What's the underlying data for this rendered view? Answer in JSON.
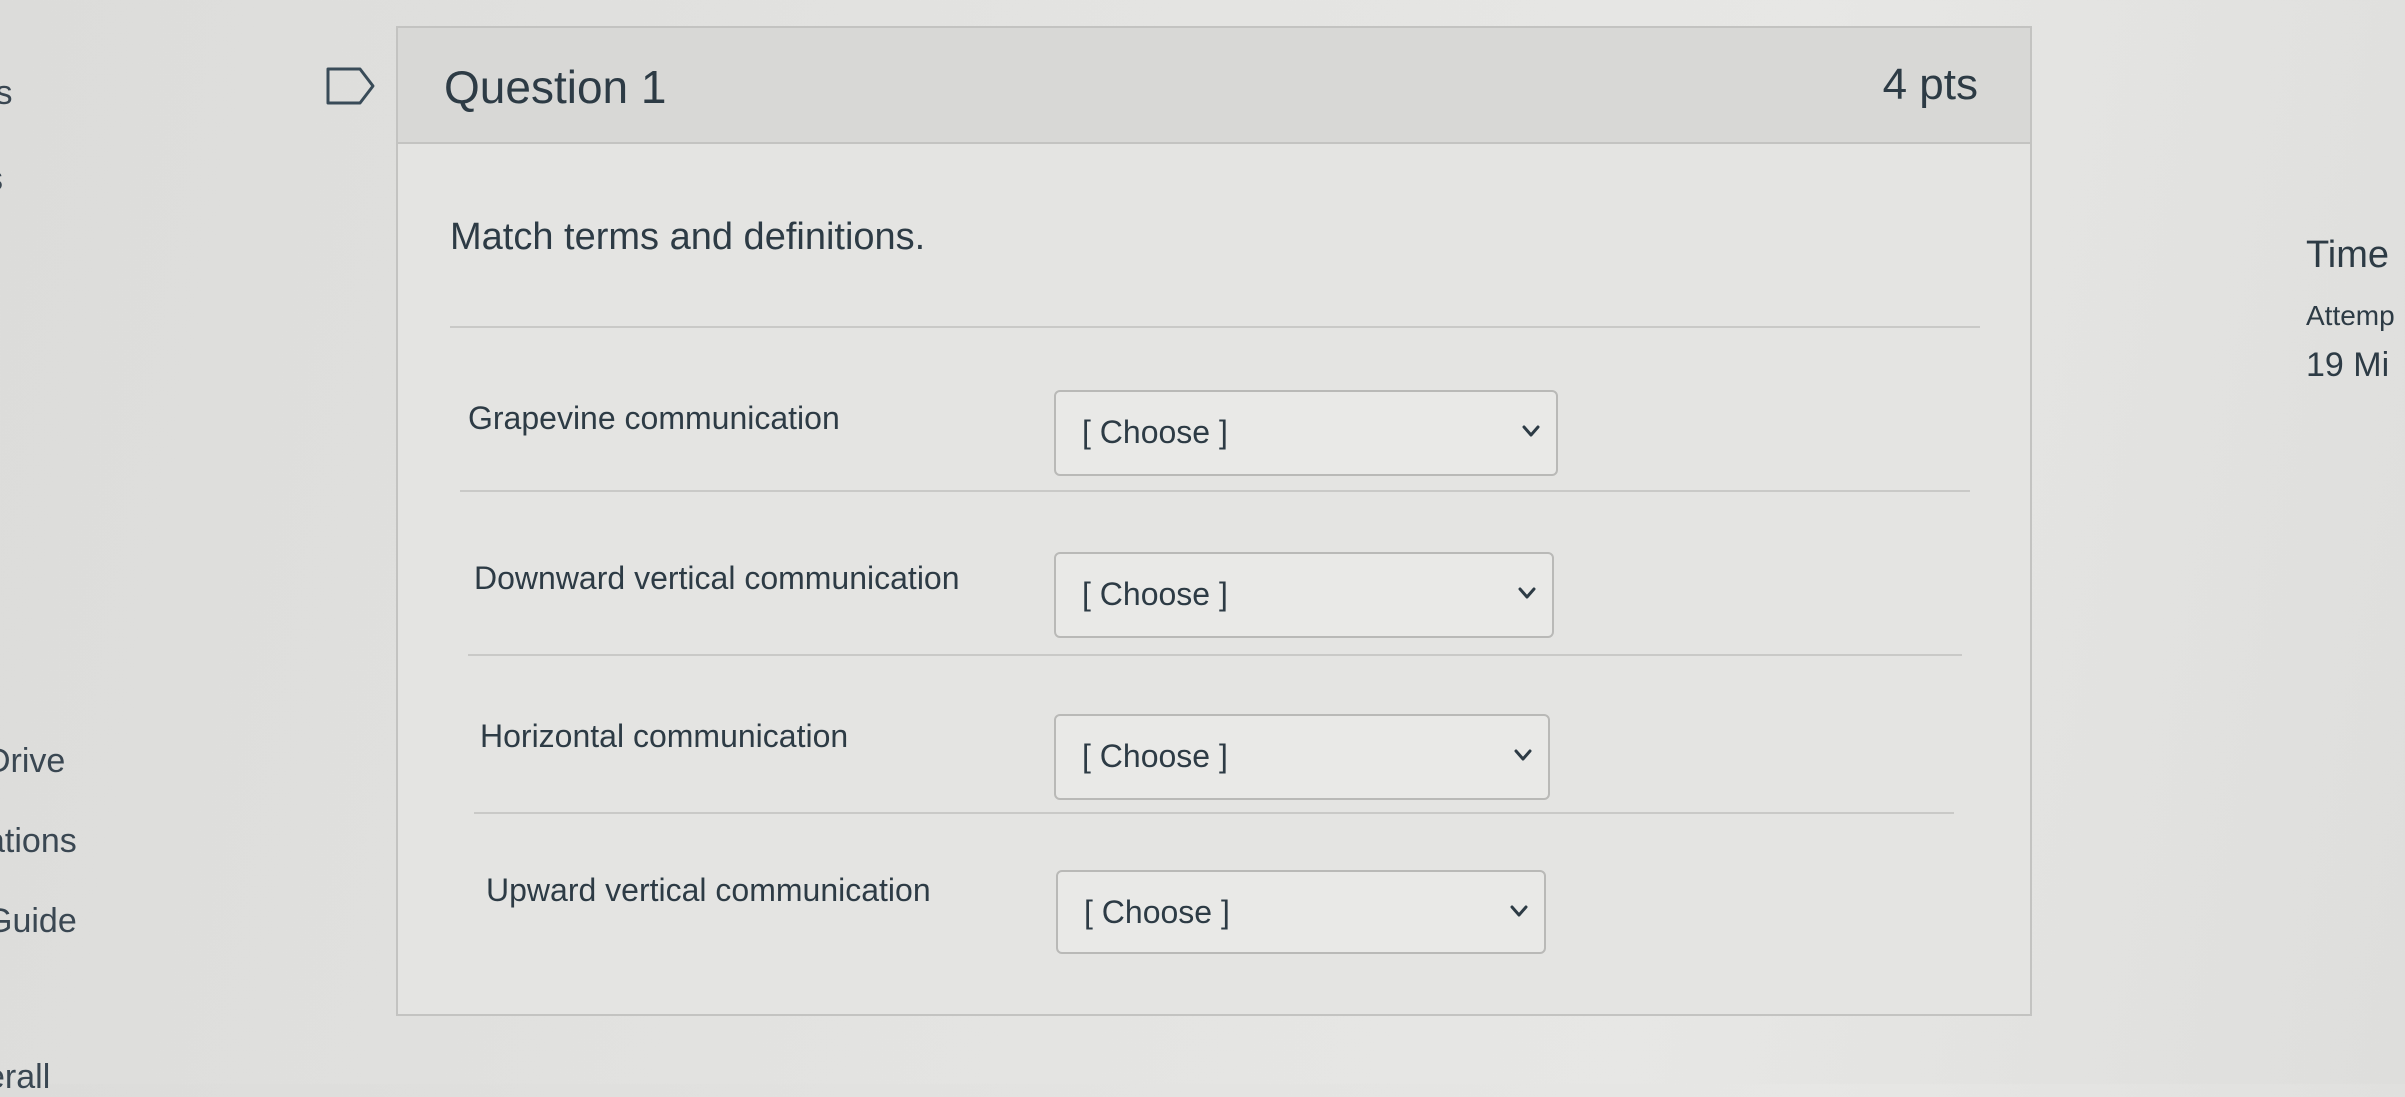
{
  "left_nav": {
    "items": [
      "ts",
      "s",
      "Drive",
      "ations",
      "Guide",
      "erall"
    ]
  },
  "question": {
    "title": "Question 1",
    "points": "4 pts",
    "prompt": "Match terms and definitions.",
    "flag_icon": "bookmark-flag-icon",
    "rows": [
      {
        "term": "Grapevine communication",
        "selected": "[ Choose ]"
      },
      {
        "term": "Downward vertical communication",
        "selected": "[ Choose ]"
      },
      {
        "term": "Horizontal communication",
        "selected": "[ Choose ]"
      },
      {
        "term": "Upward vertical communication",
        "selected": "[ Choose ]"
      }
    ]
  },
  "sidebar": {
    "time_label": "Time",
    "attempt_label": "Attemp",
    "remaining": "19 Mi"
  },
  "colors": {
    "text": "#2d3b45",
    "card_bg": "#e4e4e2",
    "header_bg": "#d8d8d6",
    "border": "#c3c3c1"
  }
}
